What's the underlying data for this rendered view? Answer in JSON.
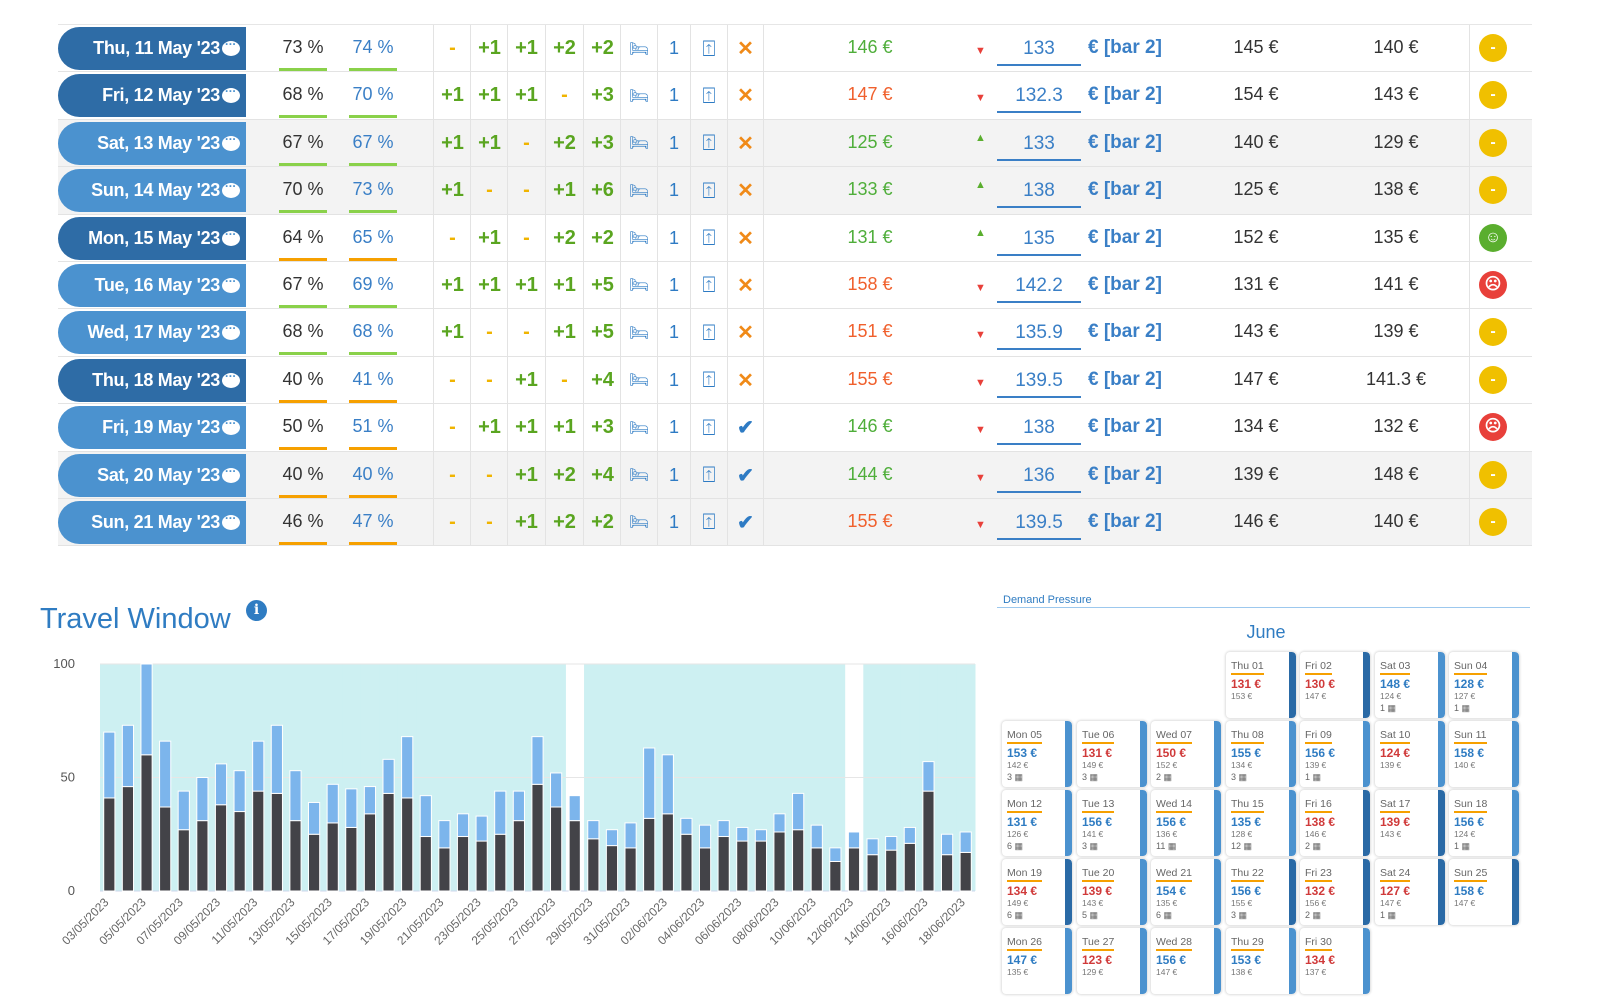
{
  "rows": [
    {
      "date": "Thu, 11 May '23",
      "pill": "dark",
      "alt": false,
      "occ1": "73 %",
      "occ2": "74 %",
      "occ_status": "green",
      "pickups": [
        "-",
        "+1",
        "+1",
        "+2",
        "+2"
      ],
      "rooms": "1",
      "ok": false,
      "price": "146 €",
      "price_color": "green",
      "trend": "down",
      "rate": "133",
      "suffix": "€ [bar 2]",
      "comp1": "145 €",
      "comp2": "140 €",
      "mood": "neutral"
    },
    {
      "date": "Fri, 12 May '23",
      "pill": "dark",
      "alt": false,
      "occ1": "68 %",
      "occ2": "70 %",
      "occ_status": "green",
      "pickups": [
        "+1",
        "+1",
        "+1",
        "-",
        "+3"
      ],
      "rooms": "1",
      "ok": false,
      "price": "147 €",
      "price_color": "red",
      "trend": "down",
      "rate": "132.3",
      "suffix": "€ [bar 2]",
      "comp1": "154 €",
      "comp2": "143 €",
      "mood": "neutral"
    },
    {
      "date": "Sat, 13 May '23",
      "pill": "light",
      "alt": true,
      "occ1": "67 %",
      "occ2": "67 %",
      "occ_status": "green",
      "pickups": [
        "+1",
        "+1",
        "-",
        "+2",
        "+3"
      ],
      "rooms": "1",
      "ok": false,
      "price": "125 €",
      "price_color": "green",
      "trend": "up",
      "rate": "133",
      "suffix": "€ [bar 2]",
      "comp1": "140 €",
      "comp2": "129 €",
      "mood": "neutral"
    },
    {
      "date": "Sun, 14 May '23",
      "pill": "light",
      "alt": true,
      "occ1": "70 %",
      "occ2": "73 %",
      "occ_status": "green",
      "pickups": [
        "+1",
        "-",
        "-",
        "+1",
        "+6"
      ],
      "rooms": "1",
      "ok": false,
      "price": "133 €",
      "price_color": "green",
      "trend": "up",
      "rate": "138",
      "suffix": "€ [bar 2]",
      "comp1": "125 €",
      "comp2": "138 €",
      "mood": "neutral"
    },
    {
      "date": "Mon, 15 May '23",
      "pill": "dark",
      "alt": false,
      "occ1": "64 %",
      "occ2": "65 %",
      "occ_status": "orange",
      "pickups": [
        "-",
        "+1",
        "-",
        "+2",
        "+2"
      ],
      "rooms": "1",
      "ok": false,
      "price": "131 €",
      "price_color": "green",
      "trend": "up",
      "rate": "135",
      "suffix": "€ [bar 2]",
      "comp1": "152 €",
      "comp2": "135 €",
      "mood": "happy"
    },
    {
      "date": "Tue, 16 May '23",
      "pill": "light",
      "alt": false,
      "occ1": "67 %",
      "occ2": "69 %",
      "occ_status": "green",
      "pickups": [
        "+1",
        "+1",
        "+1",
        "+1",
        "+5"
      ],
      "rooms": "1",
      "ok": false,
      "price": "158 €",
      "price_color": "red",
      "trend": "down",
      "rate": "142.2",
      "suffix": "€ [bar 2]",
      "comp1": "131 €",
      "comp2": "141 €",
      "mood": "sad"
    },
    {
      "date": "Wed, 17 May '23",
      "pill": "light",
      "alt": false,
      "occ1": "68 %",
      "occ2": "68 %",
      "occ_status": "green",
      "pickups": [
        "+1",
        "-",
        "-",
        "+1",
        "+5"
      ],
      "rooms": "1",
      "ok": false,
      "price": "151 €",
      "price_color": "red",
      "trend": "down",
      "rate": "135.9",
      "suffix": "€ [bar 2]",
      "comp1": "143 €",
      "comp2": "139 €",
      "mood": "neutral"
    },
    {
      "date": "Thu, 18 May '23",
      "pill": "dark",
      "alt": false,
      "occ1": "40 %",
      "occ2": "41 %",
      "occ_status": "orange",
      "pickups": [
        "-",
        "-",
        "+1",
        "-",
        "+4"
      ],
      "rooms": "1",
      "ok": false,
      "price": "155 €",
      "price_color": "red",
      "trend": "down",
      "rate": "139.5",
      "suffix": "€ [bar 2]",
      "comp1": "147 €",
      "comp2": "141.3 €",
      "mood": "neutral"
    },
    {
      "date": "Fri, 19 May '23",
      "pill": "light",
      "alt": false,
      "occ1": "50 %",
      "occ2": "51 %",
      "occ_status": "orange",
      "pickups": [
        "-",
        "+1",
        "+1",
        "+1",
        "+3"
      ],
      "rooms": "1",
      "ok": true,
      "price": "146 €",
      "price_color": "green",
      "trend": "down",
      "rate": "138",
      "suffix": "€ [bar 2]",
      "comp1": "134 €",
      "comp2": "132 €",
      "mood": "sad"
    },
    {
      "date": "Sat, 20 May '23",
      "pill": "light",
      "alt": true,
      "occ1": "40 %",
      "occ2": "40 %",
      "occ_status": "orange",
      "pickups": [
        "-",
        "-",
        "+1",
        "+2",
        "+4"
      ],
      "rooms": "1",
      "ok": true,
      "price": "144 €",
      "price_color": "green",
      "trend": "down",
      "rate": "136",
      "suffix": "€ [bar 2]",
      "comp1": "139 €",
      "comp2": "148 €",
      "mood": "neutral"
    },
    {
      "date": "Sun, 21 May '23",
      "pill": "light",
      "alt": true,
      "occ1": "46 %",
      "occ2": "47 %",
      "occ_status": "orange",
      "pickups": [
        "-",
        "-",
        "+1",
        "+2",
        "+2"
      ],
      "rooms": "1",
      "ok": true,
      "price": "155 €",
      "price_color": "red",
      "trend": "down",
      "rate": "139.5",
      "suffix": "€ [bar 2]",
      "comp1": "146 €",
      "comp2": "140 €",
      "mood": "neutral"
    }
  ],
  "colors": {
    "green": "#4fae3a",
    "red": "#f0602d",
    "occ_green": "#8ad14a",
    "occ_orange": "#f6a000",
    "mood_neutral": "#f0c000",
    "mood_happy": "#5aae2e",
    "mood_sad": "#e8403a"
  },
  "travel_window": {
    "title": "Travel Window",
    "info_icon": "i"
  },
  "chart_data": {
    "type": "bar",
    "stacked": true,
    "title": "Travel Window",
    "ylim": [
      0,
      100
    ],
    "yticks": [
      0,
      50,
      100
    ],
    "categories": [
      "03/05/2023",
      "04/05/2023",
      "05/05/2023",
      "06/05/2023",
      "07/05/2023",
      "08/05/2023",
      "09/05/2023",
      "10/05/2023",
      "11/05/2023",
      "12/05/2023",
      "13/05/2023",
      "14/05/2023",
      "15/05/2023",
      "16/05/2023",
      "17/05/2023",
      "18/05/2023",
      "19/05/2023",
      "20/05/2023",
      "21/05/2023",
      "22/05/2023",
      "23/05/2023",
      "24/05/2023",
      "25/05/2023",
      "26/05/2023",
      "27/05/2023",
      "28/05/2023",
      "29/05/2023",
      "30/05/2023",
      "31/05/2023",
      "01/06/2023",
      "02/06/2023",
      "03/06/2023",
      "04/06/2023",
      "05/06/2023",
      "06/06/2023",
      "07/06/2023",
      "08/06/2023",
      "09/06/2023",
      "10/06/2023",
      "11/06/2023",
      "12/06/2023",
      "13/06/2023",
      "14/06/2023",
      "15/06/2023",
      "16/06/2023",
      "17/06/2023",
      "18/06/2023"
    ],
    "series": [
      {
        "name": "base",
        "color": "#434348",
        "values": [
          41,
          46,
          60,
          37,
          27,
          31,
          38,
          35,
          44,
          43,
          31,
          25,
          30,
          28,
          34,
          43,
          41,
          24,
          19,
          24,
          22,
          25,
          31,
          47,
          37,
          31,
          23,
          20,
          19,
          32,
          34,
          25,
          19,
          24,
          22,
          22,
          26,
          27,
          19,
          13,
          19,
          16,
          18,
          21,
          44,
          16,
          17
        ]
      },
      {
        "name": "additional",
        "color": "#7cb5ec",
        "values": [
          29,
          27,
          40,
          29,
          17,
          19,
          18,
          18,
          22,
          30,
          22,
          14,
          17,
          17,
          12,
          15,
          27,
          18,
          12,
          10,
          11,
          19,
          13,
          21,
          15,
          11,
          8,
          7,
          11,
          31,
          26,
          7,
          10,
          7,
          6,
          5,
          8,
          16,
          10,
          6,
          7,
          7,
          6,
          7,
          13,
          9,
          9
        ]
      }
    ],
    "background": {
      "color": "#cdf0f2",
      "gaps": [
        "28/05/2023",
        "12/06/2023"
      ]
    },
    "label_every": 2
  },
  "demand": {
    "label": "Demand Pressure",
    "month": "June",
    "cards": [
      {
        "day": "Thu 01",
        "price": "131 €",
        "tone": "red",
        "ref": "153 €",
        "count": "",
        "bar": "dark"
      },
      {
        "day": "Fri 02",
        "price": "130 €",
        "tone": "red",
        "ref": "147 €",
        "count": "",
        "bar": "dark"
      },
      {
        "day": "Sat 03",
        "price": "148 €",
        "tone": "blue",
        "ref": "124 €",
        "count": "1",
        "bar": "light"
      },
      {
        "day": "Sun 04",
        "price": "128 €",
        "tone": "blue",
        "ref": "127 €",
        "count": "1",
        "bar": "light"
      },
      {
        "day": "Mon 05",
        "price": "153 €",
        "tone": "blue",
        "ref": "142 €",
        "count": "3",
        "bar": "light"
      },
      {
        "day": "Tue 06",
        "price": "131 €",
        "tone": "red",
        "ref": "149 €",
        "count": "3",
        "bar": "light"
      },
      {
        "day": "Wed 07",
        "price": "150 €",
        "tone": "red",
        "ref": "152 €",
        "count": "2",
        "bar": "light"
      },
      {
        "day": "Thu 08",
        "price": "155 €",
        "tone": "blue",
        "ref": "134 €",
        "count": "3",
        "bar": "light"
      },
      {
        "day": "Fri 09",
        "price": "156 €",
        "tone": "blue",
        "ref": "139 €",
        "count": "1",
        "bar": "light"
      },
      {
        "day": "Sat 10",
        "price": "124 €",
        "tone": "red",
        "ref": "139 €",
        "count": "",
        "bar": "light"
      },
      {
        "day": "Sun 11",
        "price": "158 €",
        "tone": "blue",
        "ref": "140 €",
        "count": "",
        "bar": "light"
      },
      {
        "day": "Mon 12",
        "price": "131 €",
        "tone": "blue",
        "ref": "126 €",
        "count": "6",
        "bar": "light"
      },
      {
        "day": "Tue 13",
        "price": "156 €",
        "tone": "blue",
        "ref": "141 €",
        "count": "3",
        "bar": "light"
      },
      {
        "day": "Wed 14",
        "price": "156 €",
        "tone": "blue",
        "ref": "136 €",
        "count": "11",
        "bar": "light"
      },
      {
        "day": "Thu 15",
        "price": "135 €",
        "tone": "blue",
        "ref": "128 €",
        "count": "12",
        "bar": "light"
      },
      {
        "day": "Fri 16",
        "price": "138 €",
        "tone": "red",
        "ref": "146 €",
        "count": "2",
        "bar": "dark"
      },
      {
        "day": "Sat 17",
        "price": "139 €",
        "tone": "red",
        "ref": "143 €",
        "count": "",
        "bar": "dark"
      },
      {
        "day": "Sun 18",
        "price": "156 €",
        "tone": "blue",
        "ref": "124 €",
        "count": "1",
        "bar": "light"
      },
      {
        "day": "Mon 19",
        "price": "134 €",
        "tone": "red",
        "ref": "149 €",
        "count": "6",
        "bar": "dark"
      },
      {
        "day": "Tue 20",
        "price": "139 €",
        "tone": "red",
        "ref": "143 €",
        "count": "5",
        "bar": "light"
      },
      {
        "day": "Wed 21",
        "price": "154 €",
        "tone": "blue",
        "ref": "135 €",
        "count": "6",
        "bar": "light"
      },
      {
        "day": "Thu 22",
        "price": "156 €",
        "tone": "blue",
        "ref": "155 €",
        "count": "3",
        "bar": "dark"
      },
      {
        "day": "Fri 23",
        "price": "132 €",
        "tone": "red",
        "ref": "156 €",
        "count": "2",
        "bar": "dark"
      },
      {
        "day": "Sat 24",
        "price": "127 €",
        "tone": "red",
        "ref": "147 €",
        "count": "1",
        "bar": "dark"
      },
      {
        "day": "Sun 25",
        "price": "158 €",
        "tone": "blue",
        "ref": "147 €",
        "count": "",
        "bar": "dark"
      },
      {
        "day": "Mon 26",
        "price": "147 €",
        "tone": "blue",
        "ref": "135 €",
        "count": "",
        "bar": "light"
      },
      {
        "day": "Tue 27",
        "price": "123 €",
        "tone": "red",
        "ref": "129 €",
        "count": "",
        "bar": "light"
      },
      {
        "day": "Wed 28",
        "price": "156 €",
        "tone": "blue",
        "ref": "147 €",
        "count": "",
        "bar": "light"
      },
      {
        "day": "Thu 29",
        "price": "153 €",
        "tone": "blue",
        "ref": "138 €",
        "count": "",
        "bar": "light"
      },
      {
        "day": "Fri 30",
        "price": "134 €",
        "tone": "red",
        "ref": "137 €",
        "count": "",
        "bar": "light"
      }
    ]
  }
}
